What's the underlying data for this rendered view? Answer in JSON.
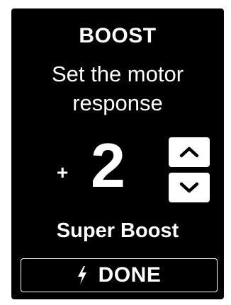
{
  "screen": {
    "title": "BOOST",
    "subtitle": "Set the motor response",
    "boost_sign": "+",
    "boost_value": "2",
    "level_name": "Super Boost",
    "done_label": "DONE"
  },
  "icons": {
    "increase": "chevron-up-icon",
    "decrease": "chevron-down-icon",
    "done": "lightning-bolt-icon"
  },
  "colors": {
    "background": "#000000",
    "foreground": "#ffffff"
  }
}
